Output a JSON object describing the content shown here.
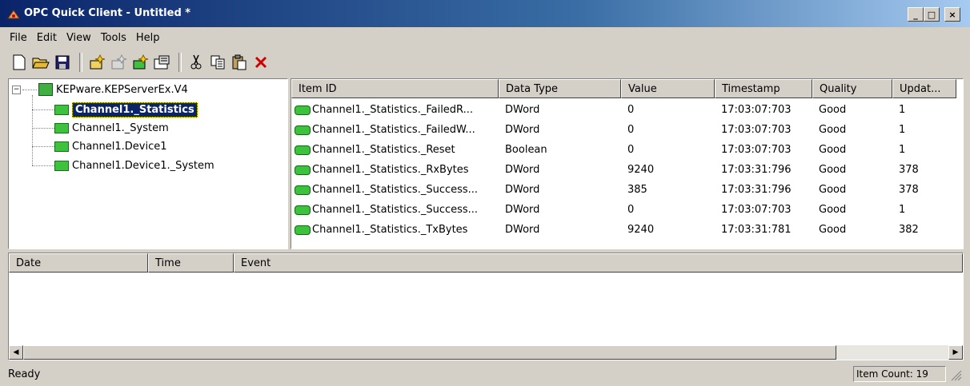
{
  "window": {
    "title": "OPC Quick Client - Untitled *",
    "min": "_",
    "max": "□",
    "close": "×"
  },
  "menu": [
    "File",
    "Edit",
    "View",
    "Tools",
    "Help"
  ],
  "tree": {
    "root": "KEPware.KEPServerEx.V4",
    "children": [
      "Channel1._Statistics",
      "Channel1._System",
      "Channel1.Device1",
      "Channel1.Device1._System"
    ]
  },
  "list": {
    "columns": [
      "Item ID",
      "Data Type",
      "Value",
      "Timestamp",
      "Quality",
      "Updat..."
    ],
    "rows": [
      [
        "Channel1._Statistics._FailedR...",
        "DWord",
        "0",
        "17:03:07:703",
        "Good",
        "1"
      ],
      [
        "Channel1._Statistics._FailedW...",
        "DWord",
        "0",
        "17:03:07:703",
        "Good",
        "1"
      ],
      [
        "Channel1._Statistics._Reset",
        "Boolean",
        "0",
        "17:03:07:703",
        "Good",
        "1"
      ],
      [
        "Channel1._Statistics._RxBytes",
        "DWord",
        "9240",
        "17:03:31:796",
        "Good",
        "378"
      ],
      [
        "Channel1._Statistics._Success...",
        "DWord",
        "385",
        "17:03:31:796",
        "Good",
        "378"
      ],
      [
        "Channel1._Statistics._Success...",
        "DWord",
        "0",
        "17:03:07:703",
        "Good",
        "1"
      ],
      [
        "Channel1._Statistics._TxBytes",
        "DWord",
        "9240",
        "17:03:31:781",
        "Good",
        "382"
      ]
    ]
  },
  "log": {
    "columns": [
      "Date",
      "Time",
      "Event"
    ]
  },
  "status": {
    "text": "Ready",
    "item_count": "Item Count: 19"
  },
  "colors": {
    "title_start": "#0a246a",
    "title_end": "#a6caf0",
    "tag_green": "#3cc23c",
    "selection": "#0a246a"
  }
}
